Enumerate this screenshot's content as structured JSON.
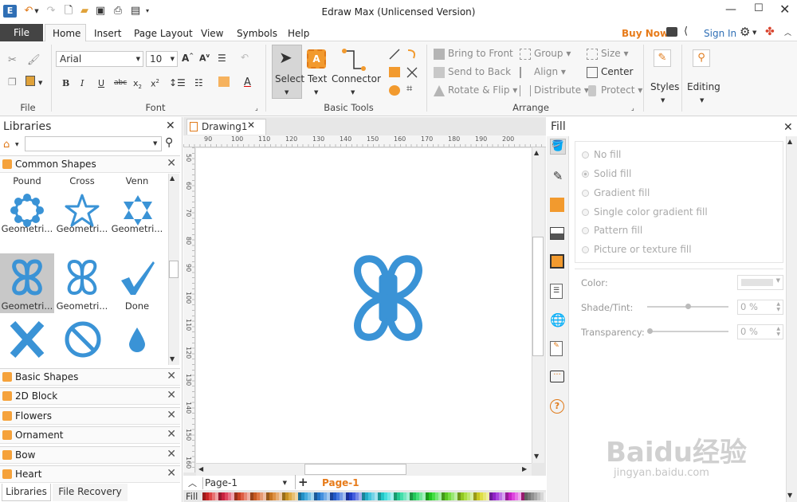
{
  "app": {
    "title": "Edraw Max (Unlicensed Version)"
  },
  "menu": {
    "file": "File",
    "tabs": [
      "Home",
      "Insert",
      "Page Layout",
      "View",
      "Symbols",
      "Help"
    ],
    "buy_now": "Buy Now",
    "sign_in": "Sign In"
  },
  "ribbon": {
    "font_name": "Arial",
    "font_size": "10",
    "groups": {
      "file": "File",
      "font": "Font",
      "basic_tools": "Basic Tools",
      "arrange": "Arrange"
    },
    "tools": {
      "select": "Select",
      "text": "Text",
      "connector": "Connector"
    },
    "arrange": {
      "bring_front": "Bring to Front",
      "send_back": "Send to Back",
      "rotate_flip": "Rotate & Flip",
      "group": "Group",
      "align": "Align",
      "distribute": "Distribute",
      "size": "Size",
      "center": "Center",
      "protect": "Protect"
    },
    "styles": "Styles",
    "editing": "Editing"
  },
  "libraries": {
    "title": "Libraries",
    "search_placeholder": "",
    "open_section": "Common Shapes",
    "shapes": [
      {
        "header": "Pound",
        "label": "Geometri..."
      },
      {
        "header": "Cross",
        "label": "Geometri..."
      },
      {
        "header": "Venn",
        "label": "Geometri..."
      },
      {
        "header": "",
        "label": "Geometri..."
      },
      {
        "header": "",
        "label": "Geometri..."
      },
      {
        "header": "",
        "label": "Done"
      }
    ],
    "sections": [
      "Basic Shapes",
      "2D Block",
      "Flowers",
      "Ornament",
      "Bow",
      "Heart"
    ],
    "bottom_tabs": [
      "Libraries",
      "File Recovery"
    ]
  },
  "document": {
    "tab": "Drawing1",
    "ruler_h": [
      "90",
      "100",
      "110",
      "120",
      "130",
      "140",
      "150",
      "160",
      "170",
      "180",
      "190",
      "200"
    ],
    "ruler_v": [
      "50",
      "60",
      "70",
      "80",
      "90",
      "100",
      "110",
      "120",
      "130",
      "140",
      "150",
      "160"
    ],
    "page_select": "Page-1",
    "active_page": "Page-1",
    "fill_label": "Fill"
  },
  "fill": {
    "title": "Fill",
    "options": [
      "No fill",
      "Solid fill",
      "Gradient fill",
      "Single color gradient fill",
      "Pattern fill",
      "Picture or texture fill"
    ],
    "color_label": "Color:",
    "shade_label": "Shade/Tint:",
    "shade_value": "0 %",
    "transparency_label": "Transparency:",
    "transparency_value": "0 %"
  },
  "colors": {
    "accent": "#2f6fb5",
    "shape_blue": "#3a93d6",
    "orange": "#f29a2e",
    "buy_now": "#e77b1a"
  },
  "watermark": {
    "text": "Baidu经验",
    "sub": "jingyan.baidu.com"
  }
}
